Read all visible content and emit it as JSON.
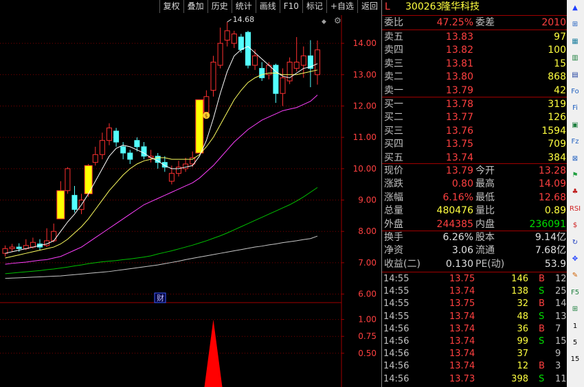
{
  "toolbar": [
    "复权",
    "叠加",
    "历史",
    "统计",
    "画线",
    "F10",
    "标记",
    "+自选",
    "返回"
  ],
  "price_labels": [
    "14.00",
    "13.00",
    "12.00",
    "11.00",
    "10.00",
    "9.00",
    "8.00",
    "7.00",
    "6.00"
  ],
  "ind_labels": [
    "1.00",
    "0.75",
    "0.50"
  ],
  "high_marker": "14.68",
  "fin_tag": "财",
  "colors": {
    "red": "#ff3030",
    "cyan": "#54ffff",
    "yellow": "#ffff00",
    "ma_white": "#ffffff",
    "ma_yellow": "#ffff60",
    "ma_magenta": "#ff40ff",
    "ma_green": "#00c000",
    "ma_gray": "#c8c8c8",
    "grid": "#800000"
  },
  "stock": {
    "flag": "L",
    "code": "300263",
    "name": "隆华科技"
  },
  "quote": {
    "wb_label": "委比",
    "wb_value": "47.25%",
    "wc_label": "委差",
    "wc_value": "2010",
    "sells": [
      {
        "label": "卖五",
        "price": "13.83",
        "vol": "97"
      },
      {
        "label": "卖四",
        "price": "13.82",
        "vol": "100"
      },
      {
        "label": "卖三",
        "price": "13.81",
        "vol": "15"
      },
      {
        "label": "卖二",
        "price": "13.80",
        "vol": "868"
      },
      {
        "label": "卖一",
        "price": "13.79",
        "vol": "42"
      }
    ],
    "buys": [
      {
        "label": "买一",
        "price": "13.78",
        "vol": "319"
      },
      {
        "label": "买二",
        "price": "13.77",
        "vol": "126"
      },
      {
        "label": "买三",
        "price": "13.76",
        "vol": "1594"
      },
      {
        "label": "买四",
        "price": "13.75",
        "vol": "709"
      },
      {
        "label": "买五",
        "price": "13.74",
        "vol": "384"
      }
    ],
    "stats": [
      {
        "l1": "现价",
        "v1": "13.79",
        "c1": "red",
        "l2": "今开",
        "v2": "13.28",
        "c2": "red"
      },
      {
        "l1": "涨跌",
        "v1": "0.80",
        "c1": "red",
        "l2": "最高",
        "v2": "14.09",
        "c2": "red"
      },
      {
        "l1": "涨幅",
        "v1": "6.16%",
        "c1": "red",
        "l2": "最低",
        "v2": "12.68",
        "c2": "red"
      },
      {
        "l1": "总量",
        "v1": "480476",
        "c1": "yellow",
        "l2": "量比",
        "v2": "0.89",
        "c2": "yellow"
      },
      {
        "l1": "外盘",
        "v1": "244385",
        "c1": "red",
        "l2": "内盘",
        "v2": "236091",
        "c2": "green"
      }
    ],
    "fund": [
      {
        "l1": "换手",
        "v1": "6.26%",
        "l2": "股本",
        "v2": "9.14亿"
      },
      {
        "l1": "净资",
        "v1": "3.06",
        "l2": "流通",
        "v2": "7.68亿"
      },
      {
        "l1": "收益(二)",
        "v1": "0.130",
        "l2": "PE(动)",
        "v2": "53.9"
      }
    ],
    "ticks": [
      {
        "time": "14:55",
        "price": "13.75",
        "vol": "146",
        "bs": "B",
        "n": "12"
      },
      {
        "time": "14:55",
        "price": "13.74",
        "vol": "138",
        "bs": "S",
        "n": "25"
      },
      {
        "time": "14:55",
        "price": "13.75",
        "vol": "32",
        "bs": "B",
        "n": "14"
      },
      {
        "time": "14:55",
        "price": "13.74",
        "vol": "48",
        "bs": "S",
        "n": "13"
      },
      {
        "time": "14:56",
        "price": "13.74",
        "vol": "36",
        "bs": "B",
        "n": "7"
      },
      {
        "time": "14:56",
        "price": "13.74",
        "vol": "99",
        "bs": "S",
        "n": "15"
      },
      {
        "time": "14:56",
        "price": "13.74",
        "vol": "37",
        "bs": "",
        "n": "9"
      },
      {
        "time": "14:56",
        "price": "13.74",
        "vol": "12",
        "bs": "B",
        "n": "3"
      },
      {
        "time": "14:56",
        "price": "13.73",
        "vol": "398",
        "bs": "S",
        "n": "11"
      }
    ]
  },
  "sidebar_icons": [
    "▲",
    "⊞",
    "▦",
    "▥",
    "▤",
    "Fo",
    "Fi",
    "▣",
    "Fz",
    "⊠",
    "⚑",
    "♣",
    "RSI",
    "$",
    "↻",
    "✥",
    "✎",
    "F5",
    "⊞",
    "1",
    "5",
    "15"
  ],
  "chart_data": {
    "type": "candlestick",
    "y_range": [
      5.75,
      14.9
    ],
    "candles": [
      {
        "o": 7.3,
        "c": 7.45,
        "h": 7.55,
        "l": 7.2
      },
      {
        "o": 7.45,
        "c": 7.5,
        "h": 7.6,
        "l": 7.35
      },
      {
        "o": 7.5,
        "c": 7.45,
        "h": 7.62,
        "l": 7.35
      },
      {
        "o": 7.45,
        "c": 7.55,
        "h": 7.75,
        "l": 7.4
      },
      {
        "o": 7.5,
        "c": 7.65,
        "h": 7.8,
        "l": 7.45
      },
      {
        "o": 7.6,
        "c": 7.5,
        "h": 7.75,
        "l": 7.4
      },
      {
        "o": 7.55,
        "c": 7.7,
        "h": 8.1,
        "l": 7.5
      },
      {
        "o": 7.7,
        "c": 8.0,
        "h": 8.25,
        "l": 7.65
      },
      {
        "o": 8.4,
        "c": 9.3,
        "h": 9.6,
        "l": 8.4
      },
      {
        "o": 9.3,
        "c": 10.0,
        "h": 10.05,
        "l": 9.2
      },
      {
        "o": 9.15,
        "c": 8.7,
        "h": 9.45,
        "l": 8.6
      },
      {
        "o": 8.7,
        "c": 9.0,
        "h": 9.2,
        "l": 8.55
      },
      {
        "o": 9.2,
        "c": 10.1,
        "h": 10.15,
        "l": 9.1
      },
      {
        "o": 10.2,
        "c": 10.45,
        "h": 10.7,
        "l": 10.1
      },
      {
        "o": 10.45,
        "c": 10.9,
        "h": 11.15,
        "l": 10.3
      },
      {
        "o": 10.9,
        "c": 11.3,
        "h": 11.45,
        "l": 10.75
      },
      {
        "o": 11.2,
        "c": 10.85,
        "h": 11.3,
        "l": 10.7
      },
      {
        "o": 10.7,
        "c": 10.5,
        "h": 10.85,
        "l": 10.3
      },
      {
        "o": 10.5,
        "c": 10.3,
        "h": 10.6,
        "l": 10.15
      },
      {
        "o": 10.9,
        "c": 10.7,
        "h": 11.0,
        "l": 10.55
      },
      {
        "o": 10.7,
        "c": 10.4,
        "h": 10.85,
        "l": 10.3
      },
      {
        "o": 10.35,
        "c": 10.4,
        "h": 10.6,
        "l": 10.2
      },
      {
        "o": 10.4,
        "c": 10.2,
        "h": 10.5,
        "l": 10.0
      },
      {
        "o": 10.2,
        "c": 10.05,
        "h": 10.4,
        "l": 9.9
      },
      {
        "o": 9.6,
        "c": 9.85,
        "h": 10.1,
        "l": 9.5
      },
      {
        "o": 9.85,
        "c": 10.05,
        "h": 10.25,
        "l": 9.75
      },
      {
        "o": 10.0,
        "c": 10.15,
        "h": 10.35,
        "l": 9.9
      },
      {
        "o": 10.15,
        "c": 10.35,
        "h": 10.55,
        "l": 10.05
      },
      {
        "o": 10.5,
        "c": 12.2,
        "h": 12.2,
        "l": 10.5
      },
      {
        "o": 11.8,
        "c": 12.3,
        "h": 12.5,
        "l": 11.6
      },
      {
        "o": 12.5,
        "c": 13.4,
        "h": 13.6,
        "l": 12.3
      },
      {
        "o": 13.3,
        "c": 14.0,
        "h": 14.5,
        "l": 13.2
      },
      {
        "o": 14.1,
        "c": 14.4,
        "h": 14.68,
        "l": 13.9
      },
      {
        "o": 14.0,
        "c": 14.3,
        "h": 14.4,
        "l": 13.85
      },
      {
        "o": 14.2,
        "c": 13.8,
        "h": 14.3,
        "l": 13.7
      },
      {
        "o": 14.35,
        "c": 13.3,
        "h": 14.4,
        "l": 13.2
      },
      {
        "o": 13.3,
        "c": 13.6,
        "h": 13.8,
        "l": 13.15
      },
      {
        "o": 13.2,
        "c": 12.9,
        "h": 13.4,
        "l": 12.8
      },
      {
        "o": 13.0,
        "c": 13.3,
        "h": 13.4,
        "l": 12.85
      },
      {
        "o": 13.3,
        "c": 12.4,
        "h": 13.35,
        "l": 12.1
      },
      {
        "o": 12.4,
        "c": 12.9,
        "h": 13.2,
        "l": 12.0
      },
      {
        "o": 12.8,
        "c": 13.4,
        "h": 13.55,
        "l": 12.7
      },
      {
        "o": 13.2,
        "c": 13.4,
        "h": 14.2,
        "l": 13.1
      },
      {
        "o": 13.3,
        "c": 13.6,
        "h": 13.9,
        "l": 12.9
      },
      {
        "o": 13.6,
        "c": 13.2,
        "h": 14.1,
        "l": 12.6
      },
      {
        "o": 13.0,
        "c": 13.79,
        "h": 14.09,
        "l": 12.68
      }
    ],
    "ma_white": [
      7.3,
      7.35,
      7.4,
      7.45,
      7.5,
      7.55,
      7.6,
      7.7,
      8.0,
      8.3,
      8.55,
      8.85,
      9.2,
      9.6,
      10.0,
      10.4,
      10.65,
      10.75,
      10.7,
      10.6,
      10.5,
      10.35,
      10.25,
      10.1,
      10.0,
      10.0,
      10.05,
      10.1,
      10.4,
      10.9,
      11.6,
      12.4,
      13.1,
      13.6,
      13.8,
      13.9,
      13.7,
      13.5,
      13.3,
      13.1,
      12.95,
      12.9,
      13.05,
      13.2,
      13.25,
      13.35
    ],
    "ma_yellow": [
      7.15,
      7.2,
      7.25,
      7.3,
      7.35,
      7.4,
      7.45,
      7.5,
      7.6,
      7.75,
      7.95,
      8.15,
      8.4,
      8.7,
      9.0,
      9.3,
      9.55,
      9.8,
      10.0,
      10.15,
      10.25,
      10.3,
      10.35,
      10.35,
      10.3,
      10.3,
      10.3,
      10.3,
      10.45,
      10.7,
      11.0,
      11.4,
      11.8,
      12.2,
      12.5,
      12.75,
      12.9,
      13.0,
      13.05,
      13.05,
      13.0,
      13.0,
      13.0,
      13.05,
      13.1,
      13.15
    ],
    "ma_magenta": [
      6.95,
      6.98,
      7.0,
      7.02,
      7.05,
      7.08,
      7.1,
      7.15,
      7.2,
      7.3,
      7.4,
      7.5,
      7.65,
      7.8,
      7.95,
      8.1,
      8.25,
      8.4,
      8.55,
      8.7,
      8.85,
      8.95,
      9.05,
      9.15,
      9.25,
      9.35,
      9.45,
      9.55,
      9.7,
      9.9,
      10.1,
      10.35,
      10.6,
      10.85,
      11.05,
      11.25,
      11.4,
      11.55,
      11.65,
      11.75,
      11.85,
      11.9,
      11.95,
      12.05,
      12.15,
      12.35
    ],
    "ma_green": [
      6.65,
      6.67,
      6.69,
      6.71,
      6.73,
      6.75,
      6.78,
      6.8,
      6.83,
      6.86,
      6.9,
      6.93,
      6.97,
      7.0,
      7.03,
      7.05,
      7.07,
      7.1,
      7.12,
      7.15,
      7.18,
      7.22,
      7.28,
      7.33,
      7.38,
      7.44,
      7.5,
      7.56,
      7.63,
      7.7,
      7.78,
      7.86,
      7.95,
      8.05,
      8.15,
      8.25,
      8.35,
      8.45,
      8.55,
      8.65,
      8.75,
      8.85,
      8.97,
      9.1,
      9.25,
      9.4
    ],
    "ma_gray": [
      6.5,
      6.51,
      6.52,
      6.53,
      6.54,
      6.55,
      6.56,
      6.57,
      6.58,
      6.6,
      6.62,
      6.64,
      6.66,
      6.68,
      6.7,
      6.72,
      6.75,
      6.78,
      6.81,
      6.84,
      6.87,
      6.9,
      6.93,
      6.97,
      7.01,
      7.05,
      7.1,
      7.14,
      7.18,
      7.22,
      7.26,
      7.3,
      7.34,
      7.38,
      7.42,
      7.46,
      7.5,
      7.53,
      7.57,
      7.6,
      7.64,
      7.67,
      7.7,
      7.74,
      7.77,
      7.85
    ],
    "indicator": {
      "y_range": [
        0,
        1.25
      ],
      "spike_index": 30,
      "spike_value": 1.0
    }
  }
}
